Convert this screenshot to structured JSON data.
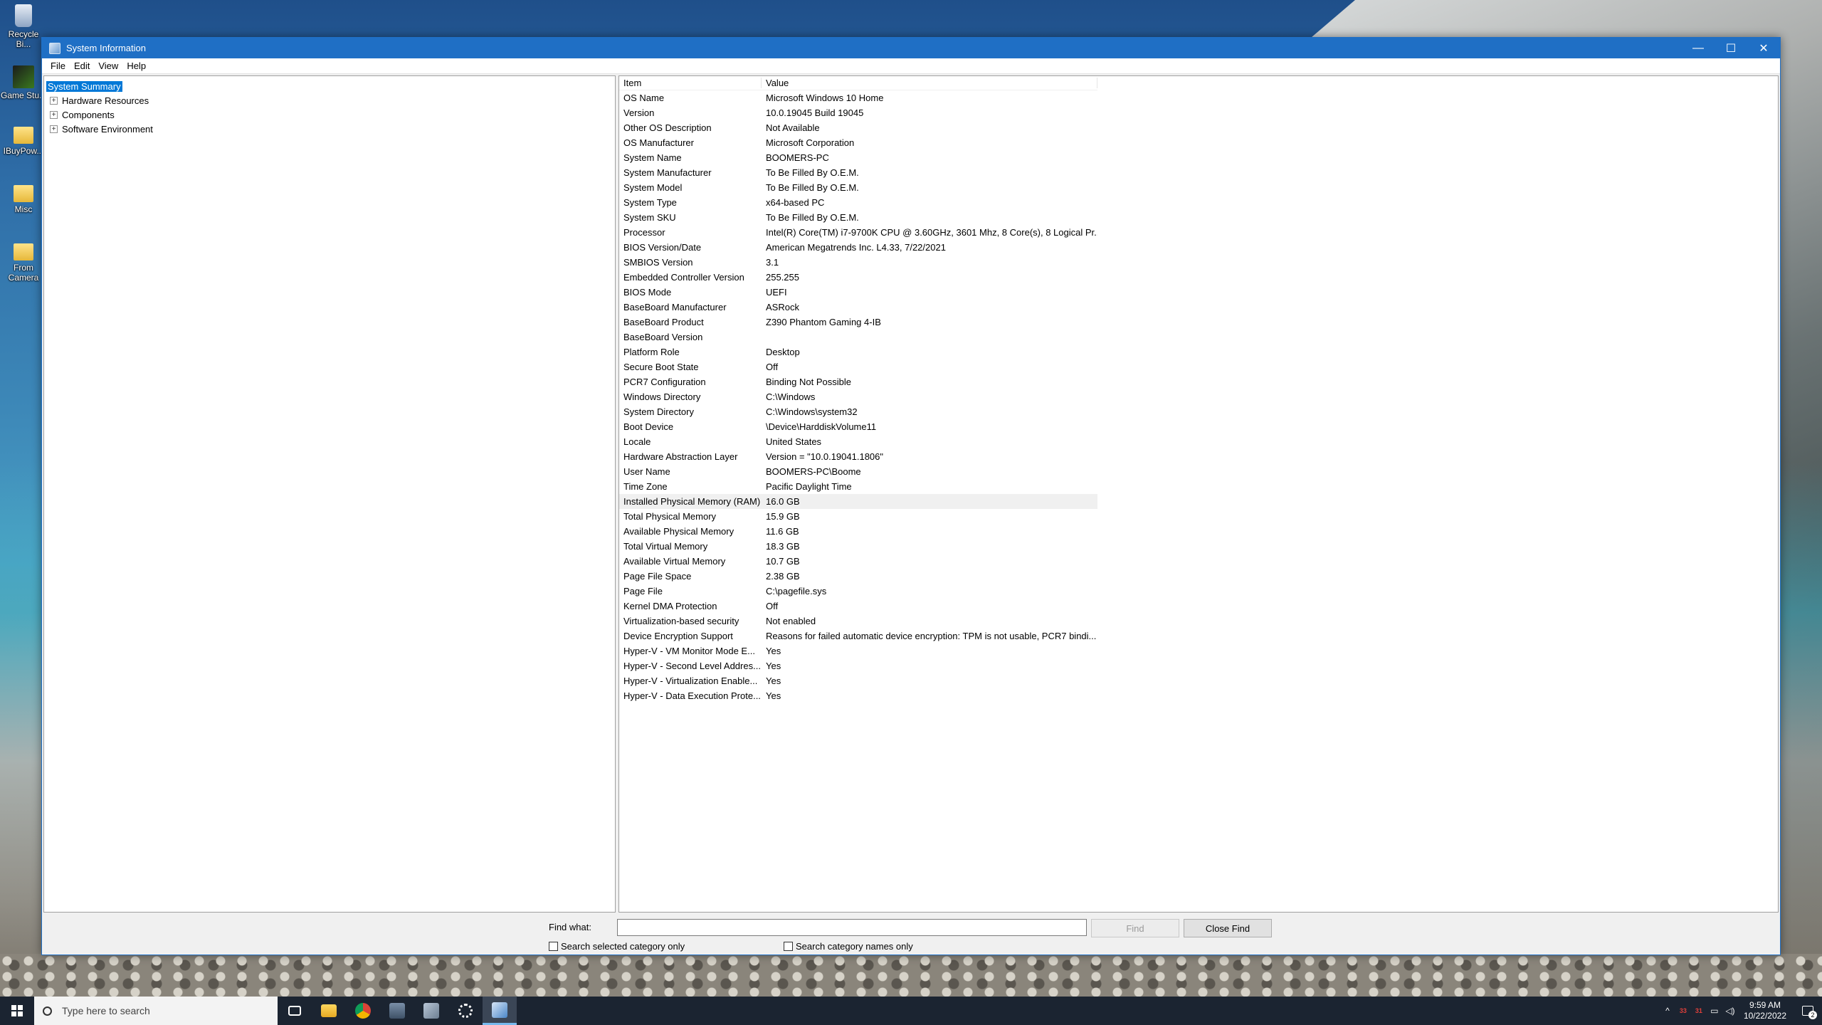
{
  "desktop": {
    "icons": [
      {
        "label": "Recycle Bin",
        "display": "Recycle Bi..."
      },
      {
        "label": "Game Stu...",
        "display": "Game Stu..."
      },
      {
        "label": "IBuyPow...",
        "display": "IBuyPow..."
      },
      {
        "label": "Misc",
        "display": "Misc"
      },
      {
        "label": "From Camera",
        "display": "From Camera"
      }
    ]
  },
  "window": {
    "title": "System Information",
    "controls": {
      "minimize": "—",
      "maximize": "☐",
      "close": "✕"
    },
    "menu": [
      "File",
      "Edit",
      "View",
      "Help"
    ],
    "tree": [
      {
        "label": "System Summary",
        "selected": true,
        "expandable": false
      },
      {
        "label": "Hardware Resources",
        "selected": false,
        "expandable": true
      },
      {
        "label": "Components",
        "selected": false,
        "expandable": true
      },
      {
        "label": "Software Environment",
        "selected": false,
        "expandable": true
      }
    ],
    "columns": {
      "item": "Item",
      "value": "Value"
    },
    "rows": [
      {
        "item": "OS Name",
        "value": "Microsoft Windows 10 Home"
      },
      {
        "item": "Version",
        "value": "10.0.19045 Build 19045"
      },
      {
        "item": "Other OS Description",
        "value": "Not Available"
      },
      {
        "item": "OS Manufacturer",
        "value": "Microsoft Corporation"
      },
      {
        "item": "System Name",
        "value": "BOOMERS-PC"
      },
      {
        "item": "System Manufacturer",
        "value": "To Be Filled By O.E.M."
      },
      {
        "item": "System Model",
        "value": "To Be Filled By O.E.M."
      },
      {
        "item": "System Type",
        "value": "x64-based PC"
      },
      {
        "item": "System SKU",
        "value": "To Be Filled By O.E.M."
      },
      {
        "item": "Processor",
        "value": "Intel(R) Core(TM) i7-9700K CPU @ 3.60GHz, 3601 Mhz, 8 Core(s), 8 Logical Pr..."
      },
      {
        "item": "BIOS Version/Date",
        "value": "American Megatrends Inc. L4.33, 7/22/2021"
      },
      {
        "item": "SMBIOS Version",
        "value": "3.1"
      },
      {
        "item": "Embedded Controller Version",
        "value": "255.255"
      },
      {
        "item": "BIOS Mode",
        "value": "UEFI"
      },
      {
        "item": "BaseBoard Manufacturer",
        "value": "ASRock"
      },
      {
        "item": "BaseBoard Product",
        "value": "Z390 Phantom Gaming 4-IB"
      },
      {
        "item": "BaseBoard Version",
        "value": ""
      },
      {
        "item": "Platform Role",
        "value": "Desktop"
      },
      {
        "item": "Secure Boot State",
        "value": "Off"
      },
      {
        "item": "PCR7 Configuration",
        "value": "Binding Not Possible"
      },
      {
        "item": "Windows Directory",
        "value": "C:\\Windows"
      },
      {
        "item": "System Directory",
        "value": "C:\\Windows\\system32"
      },
      {
        "item": "Boot Device",
        "value": "\\Device\\HarddiskVolume11"
      },
      {
        "item": "Locale",
        "value": "United States"
      },
      {
        "item": "Hardware Abstraction Layer",
        "value": "Version = \"10.0.19041.1806\""
      },
      {
        "item": "User Name",
        "value": "BOOMERS-PC\\Boome"
      },
      {
        "item": "Time Zone",
        "value": "Pacific Daylight Time"
      },
      {
        "item": "Installed Physical Memory (RAM)",
        "value": "16.0 GB",
        "highlight": true
      },
      {
        "item": "Total Physical Memory",
        "value": "15.9 GB"
      },
      {
        "item": "Available Physical Memory",
        "value": "11.6 GB"
      },
      {
        "item": "Total Virtual Memory",
        "value": "18.3 GB"
      },
      {
        "item": "Available Virtual Memory",
        "value": "10.7 GB"
      },
      {
        "item": "Page File Space",
        "value": "2.38 GB"
      },
      {
        "item": "Page File",
        "value": "C:\\pagefile.sys"
      },
      {
        "item": "Kernel DMA Protection",
        "value": "Off"
      },
      {
        "item": "Virtualization-based security",
        "value": "Not enabled"
      },
      {
        "item": "Device Encryption Support",
        "value": "Reasons for failed automatic device encryption: TPM is not usable, PCR7 bindi..."
      },
      {
        "item": "Hyper-V - VM Monitor Mode E...",
        "value": "Yes"
      },
      {
        "item": "Hyper-V - Second Level Addres...",
        "value": "Yes"
      },
      {
        "item": "Hyper-V - Virtualization Enable...",
        "value": "Yes"
      },
      {
        "item": "Hyper-V - Data Execution Prote...",
        "value": "Yes"
      }
    ],
    "find": {
      "label": "Find what:",
      "value": "",
      "find_button": "Find",
      "close_button": "Close Find",
      "check_selected": "Search selected category only",
      "check_names": "Search category names only"
    }
  },
  "taskbar": {
    "search_placeholder": "Type here to search",
    "apps": [
      "task-view",
      "file-explorer",
      "chrome",
      "calculator",
      "photos",
      "settings",
      "system-information"
    ],
    "tray": {
      "temp1": "33",
      "temp2": "31"
    },
    "clock": {
      "time": "9:59 AM",
      "date": "10/22/2022"
    },
    "notification_count": "2"
  }
}
